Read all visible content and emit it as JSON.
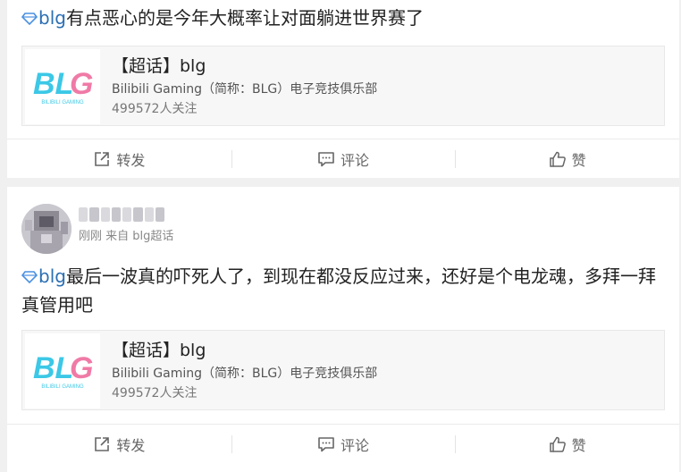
{
  "posts": [
    {
      "text_topic": "blg",
      "text_body": "有点恶心的是今年大概率让对面躺进世界赛了",
      "card": {
        "title": "【超话】blg",
        "description": "Bilibili Gaming（简称：BLG）电子竞技俱乐部",
        "followers": "499572人关注",
        "logo_text": "BILIBILI GAMING"
      },
      "actions": {
        "repost": "转发",
        "comment": "评论",
        "like": "赞"
      }
    },
    {
      "meta": "刚刚 来自 blg超话",
      "text_topic": "blg",
      "text_body": "最后一波真的吓死人了，到现在都没反应过来，还好是个电龙魂，多拜一拜真管用吧",
      "card": {
        "title": "【超话】blg",
        "description": "Bilibili Gaming（简称：BLG）电子竞技俱乐部",
        "followers": "499572人关注",
        "logo_text": "BILIBILI GAMING"
      },
      "actions": {
        "repost": "转发",
        "comment": "评论",
        "like": "赞"
      }
    }
  ],
  "icons": {
    "topic": "diamond-icon",
    "repost": "share-icon",
    "comment": "comment-icon",
    "like": "thumbs-up-icon"
  },
  "colors": {
    "topic_link": "#2b6fb3",
    "logo_cyan": "#3cc8e6",
    "logo_pink": "#f07aa6"
  }
}
